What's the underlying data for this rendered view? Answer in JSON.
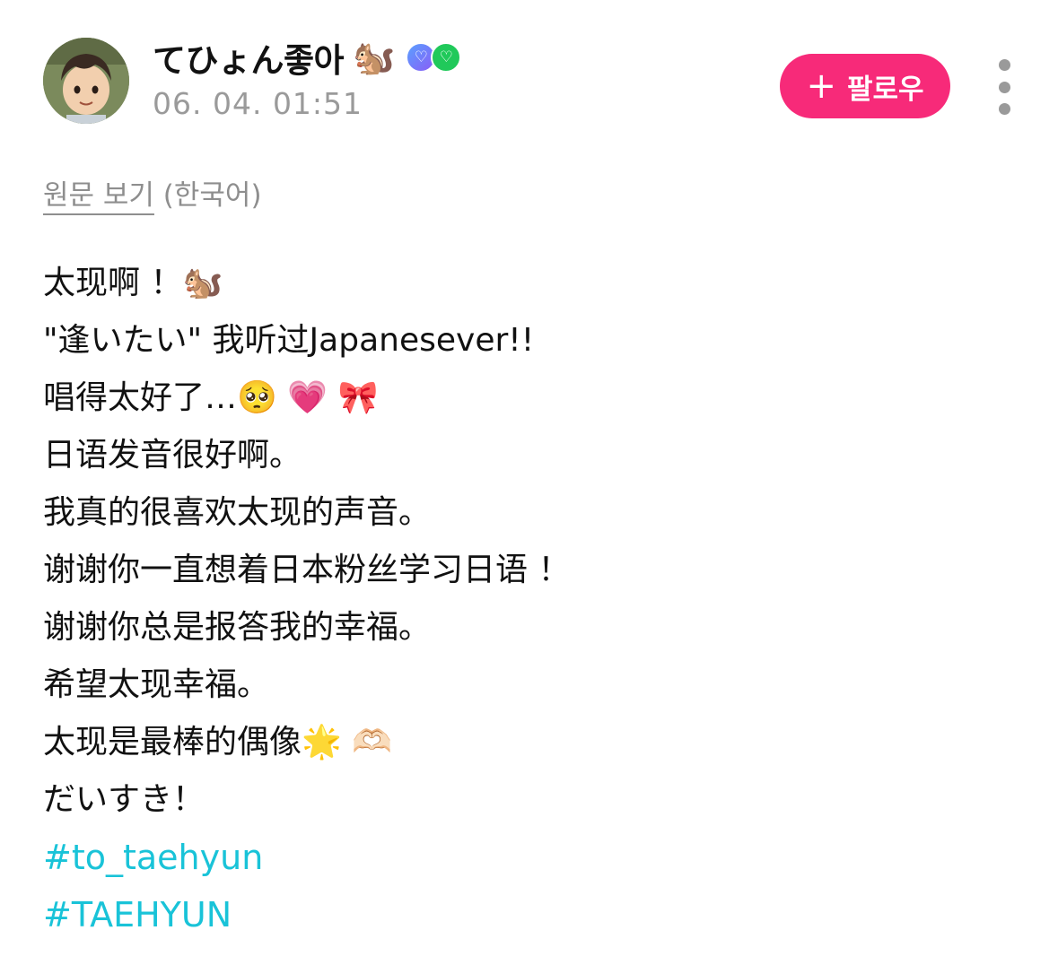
{
  "author": {
    "name": "てひょん좋아",
    "name_emoji": "🐿️",
    "timestamp": "06. 04. 01:51",
    "avatar_icon": "anime-boy-avatar",
    "badges": [
      "heart-badge-blue",
      "heart-badge-green"
    ]
  },
  "actions": {
    "follow_label": "팔로우",
    "follow_icon": "+",
    "more_icon": "vertical-dots-icon",
    "accent_color": "#f72a79"
  },
  "translation": {
    "view_original": "원문 보기",
    "language": "(한국어)"
  },
  "content": {
    "lines": [
      "太现啊 ！🐿️",
      "\"逢いたい\" 我听过Japanesever!!",
      "唱得太好了…🥺 💗 🎀",
      "日语发音很好啊。",
      "我真的很喜欢太现的声音。",
      "谢谢你一直想着日本粉丝学习日语 ！",
      "谢谢你总是报答我的幸福。",
      "希望太现幸福。",
      "太现是最棒的偶像🌟 🫶🏻",
      "だいすき！"
    ],
    "hashtags": [
      "#to_taehyun",
      "#TAEHYUN"
    ],
    "hashtag_color": "#19c3d8"
  }
}
